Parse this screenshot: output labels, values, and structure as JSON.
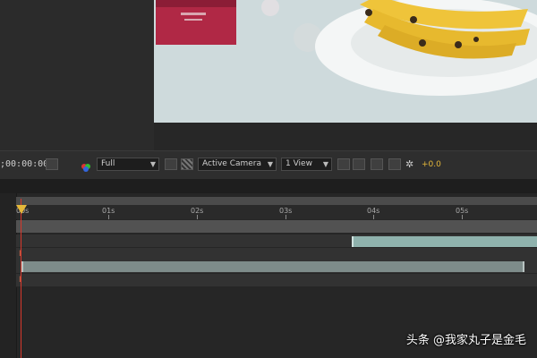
{
  "toolbar": {
    "timecode": ";00:00:00",
    "resolution": "Full",
    "camera": "Active Camera",
    "views": "1 View",
    "exposure": "+0.0",
    "dropdown_arrow": "▼"
  },
  "ruler": {
    "labels": [
      "00s",
      "01s",
      "02s",
      "03s",
      "04s",
      "05s"
    ]
  },
  "timeline": {
    "in_marker": "I"
  },
  "watermark": "头条 @我家丸子是金毛",
  "colors": {
    "accent": "#e5b83a",
    "playhead": "#d8382c",
    "layer_teal": "#8fb2ad",
    "layer_gray": "#7e8c8a"
  }
}
